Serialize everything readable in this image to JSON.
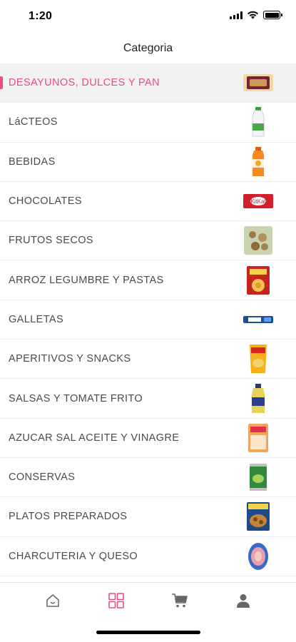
{
  "status": {
    "time": "1:20"
  },
  "header": {
    "title": "Categoria"
  },
  "categories": [
    {
      "label": "DESAYUNOS, DULCES Y PAN",
      "icon": "cookie-pack-icon",
      "active": true
    },
    {
      "label": "LáCTEOS",
      "icon": "milk-bottle-icon",
      "active": false
    },
    {
      "label": "BEBIDAS",
      "icon": "juice-bottle-icon",
      "active": false
    },
    {
      "label": "CHOCOLATES",
      "icon": "chocolate-bar-icon",
      "active": false
    },
    {
      "label": "FRUTOS SECOS",
      "icon": "nuts-bag-icon",
      "active": false
    },
    {
      "label": "ARROZ LEGUMBRE Y PASTAS",
      "icon": "pasta-box-icon",
      "active": false
    },
    {
      "label": "GALLETAS",
      "icon": "biscuit-pack-icon",
      "active": false
    },
    {
      "label": "APERITIVOS Y SNACKS",
      "icon": "snack-bag-icon",
      "active": false
    },
    {
      "label": "SALSAS Y TOMATE FRITO",
      "icon": "sauce-bottle-icon",
      "active": false
    },
    {
      "label": "AZUCAR SAL ACEITE Y VINAGRE",
      "icon": "sugar-bag-icon",
      "active": false
    },
    {
      "label": "CONSERVAS",
      "icon": "canned-food-icon",
      "active": false
    },
    {
      "label": "PLATOS PREPARADOS",
      "icon": "ready-meal-icon",
      "active": false
    },
    {
      "label": "CHARCUTERIA Y QUESO",
      "icon": "cold-cuts-icon",
      "active": false
    }
  ],
  "tabs": [
    {
      "name": "home",
      "icon": "home-icon",
      "active": false
    },
    {
      "name": "categories",
      "icon": "grid-icon",
      "active": true
    },
    {
      "name": "cart",
      "icon": "cart-icon",
      "active": false
    },
    {
      "name": "profile",
      "icon": "user-icon",
      "active": false
    }
  ],
  "colors": {
    "accent": "#e84c7d",
    "active_row_bg": "#f2f2f2",
    "text": "#4a4a4a",
    "divider": "#ececec"
  }
}
